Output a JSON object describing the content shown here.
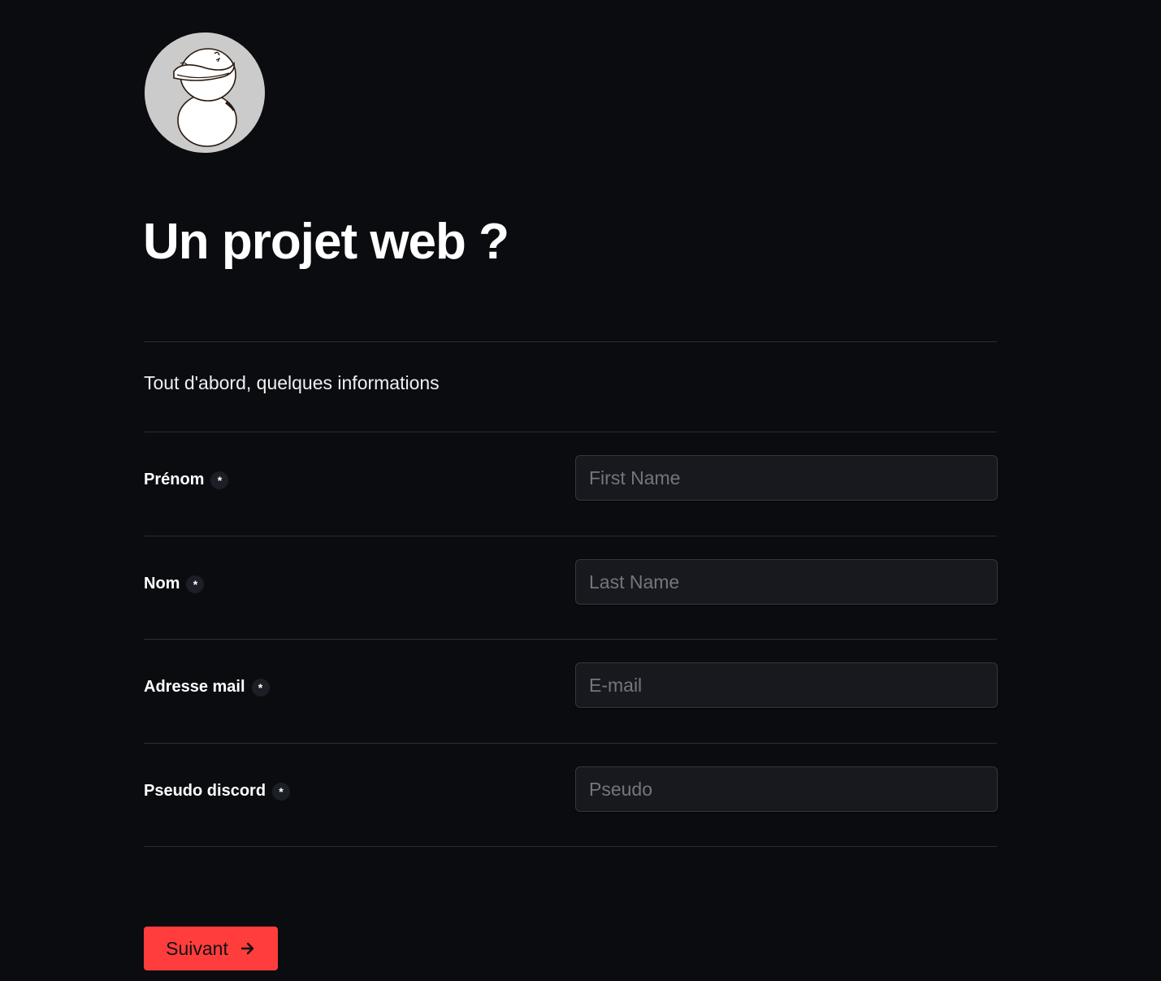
{
  "header": {
    "avatar_icon": "duck-avatar-icon",
    "title": "Un projet web ?"
  },
  "form": {
    "intro": "Tout d'abord, quelques informations",
    "required_marker": "*",
    "fields": [
      {
        "label": "Prénom",
        "placeholder": "First Name",
        "value": ""
      },
      {
        "label": "Nom",
        "placeholder": "Last Name",
        "value": ""
      },
      {
        "label": "Adresse mail",
        "placeholder": "E-mail",
        "value": ""
      },
      {
        "label": "Pseudo discord",
        "placeholder": "Pseudo",
        "value": ""
      }
    ],
    "next_label": "Suivant",
    "next_icon": "arrow-right-icon"
  },
  "colors": {
    "background": "#0a0c10",
    "accent": "#ff3d3d",
    "input_background": "#17191e",
    "divider": "#2a2d33"
  }
}
